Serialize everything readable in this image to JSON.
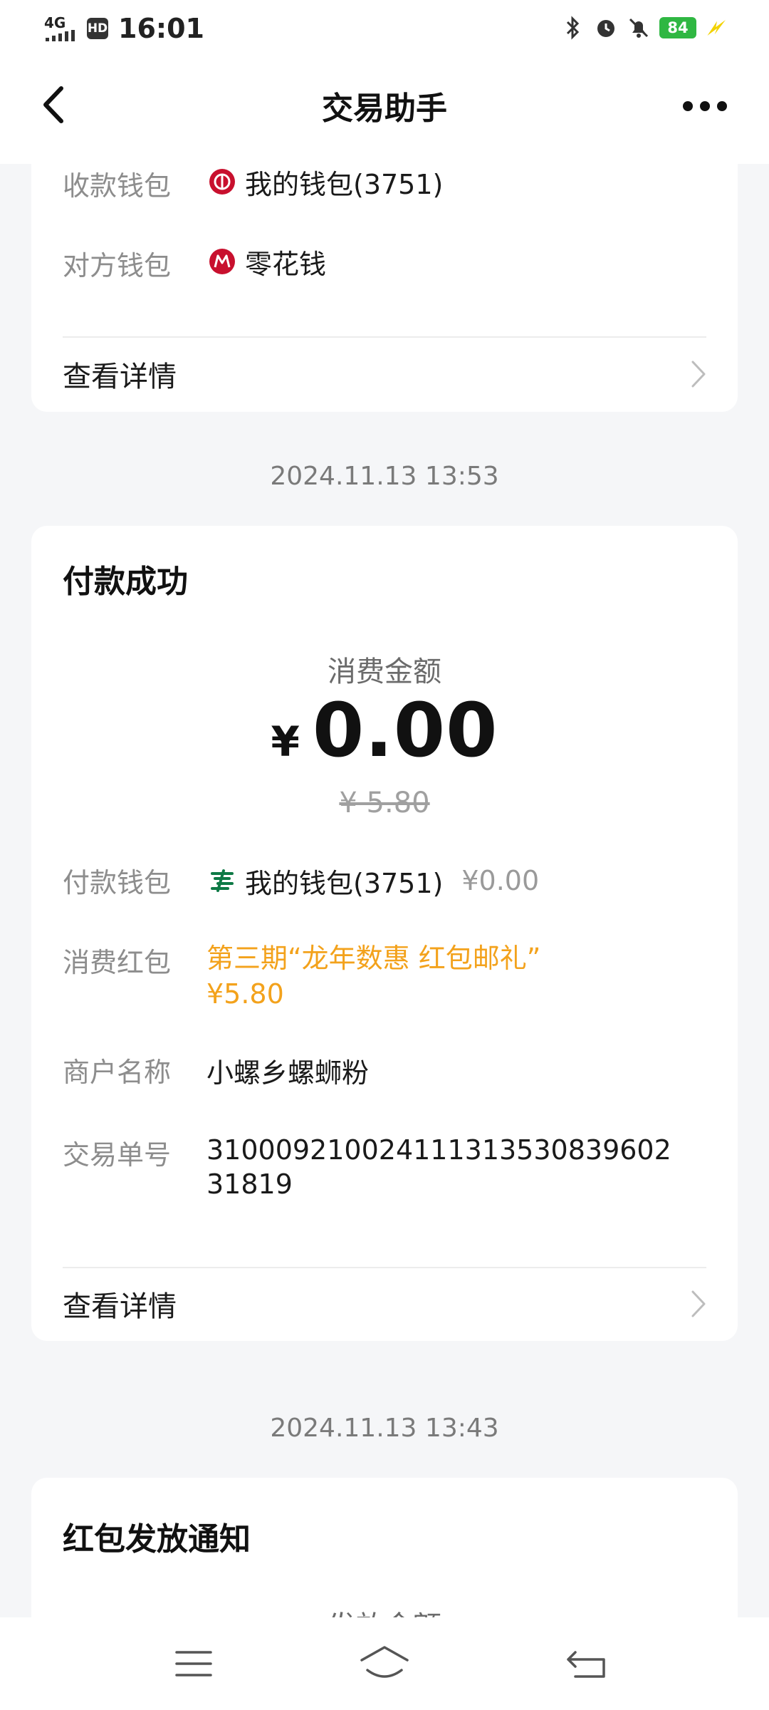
{
  "status": {
    "network": "4G",
    "hd": "HD",
    "time": "16:01",
    "battery": "84"
  },
  "header": {
    "title": "交易助手"
  },
  "card_prev": {
    "receive_label": "收款钱包",
    "receive_value": "我的钱包(3751)",
    "counterparty_label": "对方钱包",
    "counterparty_value": "零花钱",
    "details_label": "查看详情"
  },
  "timestamp1": "2024.11.13 13:53",
  "card_payment": {
    "title": "付款成功",
    "amount_label": "消费金额",
    "currency": "¥",
    "amount": "0.00",
    "original_amount": "¥ 5.80",
    "rows": {
      "pay_wallet_label": "付款钱包",
      "pay_wallet_value": "我的钱包(3751)",
      "pay_wallet_amount": "¥0.00",
      "redpacket_label": "消费红包",
      "redpacket_line1": "第三期“龙年数惠 红包邮礼”",
      "redpacket_line2": "¥5.80",
      "merchant_label": "商户名称",
      "merchant_value": "小螺乡螺蛳粉",
      "order_label": "交易单号",
      "order_line1": "31000921002411131353083960​2",
      "order_line2": "31819"
    },
    "details_label": "查看详情"
  },
  "timestamp2": "2024.11.13 13:43",
  "card_next": {
    "title": "红包发放通知",
    "amount_label": "发放金额"
  },
  "colors": {
    "accent_orange": "#f3a21c",
    "ecny_red": "#c8102e",
    "post_green": "#0e7a46",
    "battery_green": "#2fb742"
  }
}
